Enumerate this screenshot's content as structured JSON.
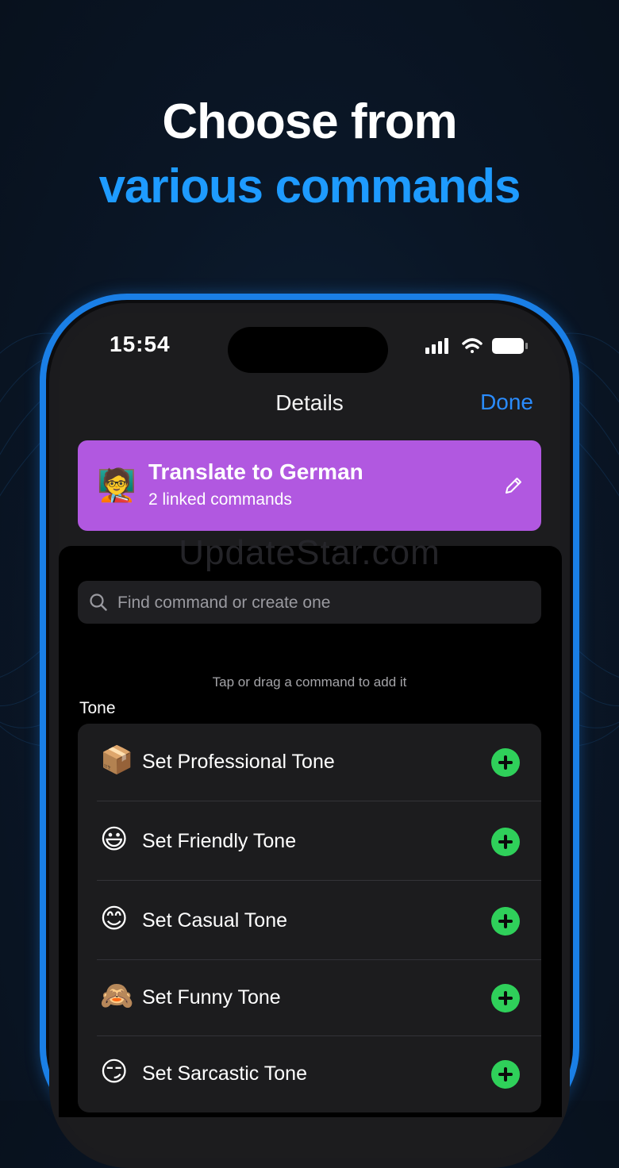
{
  "headline": {
    "line1": "Choose from",
    "line2": "various commands"
  },
  "status_bar": {
    "time": "15:54",
    "icons": [
      "cellular-signal-icon",
      "wifi-icon",
      "battery-icon"
    ]
  },
  "nav": {
    "title": "Details",
    "done_label": "Done"
  },
  "command_card": {
    "emoji": "🧑‍🏫",
    "title": "Translate to German",
    "subtitle": "2 linked commands",
    "icon": "pencil-icon",
    "color": "#b158e0"
  },
  "watermark": "UpdateStar.com",
  "search": {
    "placeholder": "Find command or create one",
    "value": ""
  },
  "hint": "Tap or drag a command to add it",
  "section_title": "Tone",
  "commands": [
    {
      "emoji": "📦",
      "label": "Set Professional Tone"
    },
    {
      "emoji": "😃",
      "label": "Set Friendly Tone"
    },
    {
      "emoji": "😊",
      "label": "Set Casual Tone"
    },
    {
      "emoji": "🙈",
      "label": "Set Funny Tone"
    },
    {
      "emoji": "😏",
      "label": "Set Sarcastic Tone"
    }
  ],
  "colors": {
    "accent": "#2a8cff",
    "headline_accent": "#1e9bff",
    "add_button": "#2fd05a",
    "phone_frame": "#1a7fe6"
  }
}
